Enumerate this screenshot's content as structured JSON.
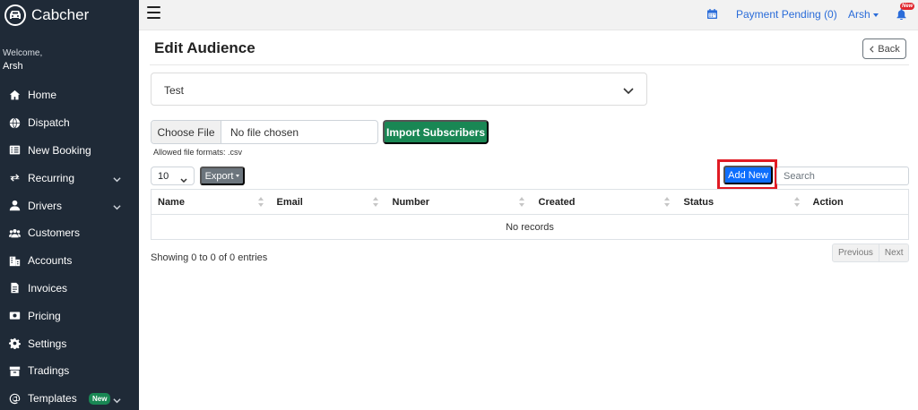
{
  "brand": {
    "name": "Cabcher"
  },
  "welcome": {
    "greeting": "Welcome,",
    "user": "Arsh"
  },
  "sidebar": {
    "items": [
      {
        "label": "Home",
        "icon": "home-icon"
      },
      {
        "label": "Dispatch",
        "icon": "globe-icon"
      },
      {
        "label": "New Booking",
        "icon": "list-icon"
      },
      {
        "label": "Recurring",
        "icon": "repeat-icon",
        "expandable": true
      },
      {
        "label": "Drivers",
        "icon": "user-icon",
        "expandable": true
      },
      {
        "label": "Customers",
        "icon": "users-icon"
      },
      {
        "label": "Accounts",
        "icon": "building-icon"
      },
      {
        "label": "Invoices",
        "icon": "file-icon"
      },
      {
        "label": "Pricing",
        "icon": "money-icon"
      },
      {
        "label": "Settings",
        "icon": "gear-icon"
      },
      {
        "label": "Tradings",
        "icon": "box-icon"
      },
      {
        "label": "Templates",
        "icon": "at-icon",
        "badge": "New",
        "expandable": true
      }
    ]
  },
  "topbar": {
    "payment_pending": "Payment Pending (0)",
    "user": "Arsh",
    "notification_badge": "New"
  },
  "page": {
    "title": "Edit Audience",
    "back_label": "Back"
  },
  "audience_select": {
    "value": "Test"
  },
  "file_upload": {
    "button_label": "Choose File",
    "file_name": "No file chosen",
    "import_label": "Import Subscribers",
    "allowed": "Allowed file formats: .csv"
  },
  "table_controls": {
    "page_length": "10",
    "export_label": "Export",
    "add_new_label": "Add New",
    "search_placeholder": "Search"
  },
  "table": {
    "columns": [
      "Name",
      "Email",
      "Number",
      "Created",
      "Status",
      "Action"
    ],
    "empty_message": "No records"
  },
  "footer": {
    "info": "Showing 0 to 0 of 0 entries",
    "previous": "Previous",
    "next": "Next"
  },
  "colors": {
    "sidebar_bg": "#1f2a37",
    "primary": "#0d6efd",
    "success": "#198754",
    "link": "#2a6cd9",
    "highlight": "#e01b24"
  }
}
